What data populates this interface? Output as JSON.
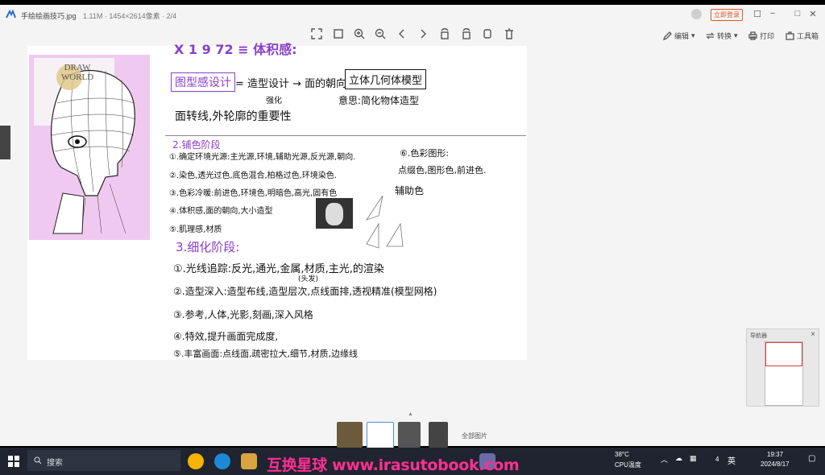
{
  "window": {
    "file_name": "手绘绘画技巧.jpg",
    "file_info": "1.11M · 1454×2614像素 · 2/4",
    "open_button": "立即登录",
    "controls": [
      "☐",
      "−",
      "□",
      "✕"
    ]
  },
  "toolbar": {
    "tools": [
      "fit-screen",
      "actual-size",
      "zoom-in",
      "zoom-out",
      "previous",
      "next",
      "rotate-left",
      "rotate-right",
      "bookmark",
      "delete"
    ],
    "right_actions": [
      {
        "label": "编辑",
        "icon": "edit-icon"
      },
      {
        "label": "转换",
        "icon": "convert-icon"
      },
      {
        "label": "打印",
        "icon": "print-icon"
      },
      {
        "label": "工具箱",
        "icon": "toolbox-icon"
      }
    ]
  },
  "image": {
    "logo_text": "DRAW WORLD",
    "top_line": "X 1 9 72 ≡ 体积感:",
    "line_a_box": "图型感设计",
    "line_a_rest": "= 造型设计 → 面的朝向",
    "line_a_box2": "立体几何体模型",
    "line_a_sub": "意思:简化物体造型",
    "line_a_annot": "强化",
    "line_b": "面转线,外轮廓的重要性",
    "section2_title": "2.铺色阶段",
    "section2_items": [
      "①.确定环境光源:主光源,环境,辅助光源,反光源,朝向.",
      "②.染色,透光过色,底色混合,柏格过色,环境染色.",
      "③.色彩冷暖:前进色,环境色,明暗色,高光,固有色",
      "④.体积感,面的朝向,大小造型",
      "⑤.肌理感,材质"
    ],
    "side_list_title": "⑥.色彩图形:",
    "side_list_line": "点缀色,图形色,前进色.",
    "side_list_line2": "辅助色",
    "section3_title": "3.细化阶段:",
    "section3_items": [
      "①.光线追踪:反光,通光,金属,材质,主光,的渲染",
      "②.造型深入:造型布线,造型层次,点线面排,透视精准(模型网格)",
      "③.参考,人体,光影,刻画,深入风格",
      "④.特效,提升画面完成度,",
      "⑤.丰富画面:点线面,疏密拉大,细节,材质,边缘线"
    ],
    "section3_annot": "(头发)"
  },
  "minimap": {
    "title": "导航器"
  },
  "thumbnails": {
    "label": "全部图片"
  },
  "taskbar": {
    "search_label": "搜索",
    "weather_temp": "38°C",
    "weather_label": "CPU温度",
    "ime": "英",
    "time": "19:37",
    "date": "2024/8/17",
    "volume": "4"
  },
  "watermark": "互换星球 www.irasutobook.com"
}
